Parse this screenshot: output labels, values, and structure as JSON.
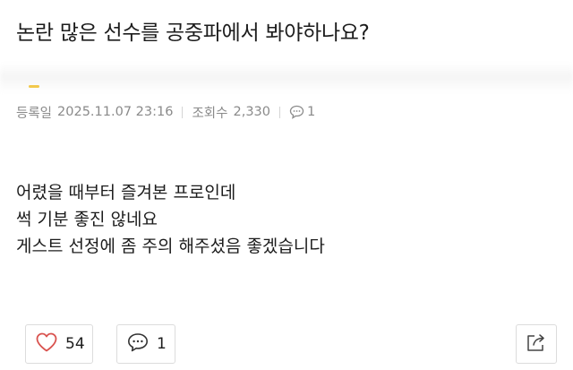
{
  "post": {
    "title": "논란 많은 선수를 공중파에서 봐야하나요?",
    "meta": {
      "date_label": "등록일",
      "date_value": "2025.11.07 23:16",
      "views_label": "조회수",
      "views_value": "2,330",
      "comment_count": "1"
    },
    "body_lines": [
      "어렸을 때부터 즐겨본 프로인데",
      "썩 기분 좋진 않네요",
      "게스트 선정에 좀 주의 해주셨음 좋겠습니다"
    ]
  },
  "actions": {
    "like_count": "54",
    "comment_count": "1"
  },
  "colors": {
    "text": "#1c1c1c",
    "meta_text": "#8a8a8a",
    "border": "#dcdcdc",
    "heart": "#d9534f"
  },
  "icons": {
    "heart": "heart-icon",
    "comment": "comment-icon",
    "share": "share-icon"
  }
}
